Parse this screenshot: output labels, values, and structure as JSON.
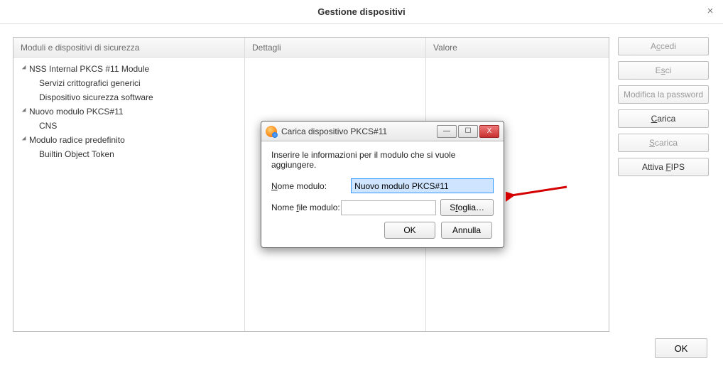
{
  "window": {
    "title": "Gestione dispositivi",
    "close_glyph": "×"
  },
  "columns": {
    "tree_header": "Moduli e dispositivi di sicurezza",
    "details_header": "Dettagli",
    "value_header": "Valore"
  },
  "tree": {
    "item0": {
      "label": "NSS Internal PKCS #11 Module"
    },
    "item1": {
      "label": "Servizi crittografici generici"
    },
    "item2": {
      "label": "Dispositivo sicurezza software"
    },
    "item3": {
      "label": "Nuovo modulo PKCS#11"
    },
    "item4": {
      "label": "CNS"
    },
    "item5": {
      "label": "Modulo radice predefinito"
    },
    "item6": {
      "label": "Builtin Object Token"
    }
  },
  "sidebar": {
    "login_pre": "A",
    "login_u": "c",
    "login_post": "cedi",
    "logout_pre": "E",
    "logout_u": "s",
    "logout_post": "ci",
    "changepw": "Modifica la password",
    "load_pre": "",
    "load_u": "C",
    "load_post": "arica",
    "unload_pre": "",
    "unload_u": "S",
    "unload_post": "carica",
    "fips_pre": "Attiva ",
    "fips_u": "F",
    "fips_post": "IPS"
  },
  "footer": {
    "ok": "OK"
  },
  "modal": {
    "title": "Carica dispositivo PKCS#11",
    "min_glyph": "—",
    "max_glyph": "☐",
    "close_glyph": "X",
    "instruction": "Inserire le informazioni per il modulo che si vuole aggiungere.",
    "name_label_pre": "",
    "name_label_u": "N",
    "name_label_post": "ome modulo:",
    "file_label_pre": "Nome ",
    "file_label_u": "f",
    "file_label_post": "ile modulo:",
    "name_value": "Nuovo modulo PKCS#11",
    "file_value": "",
    "browse_pre": "S",
    "browse_u": "f",
    "browse_post": "oglia…",
    "ok": "OK",
    "cancel": "Annulla"
  }
}
